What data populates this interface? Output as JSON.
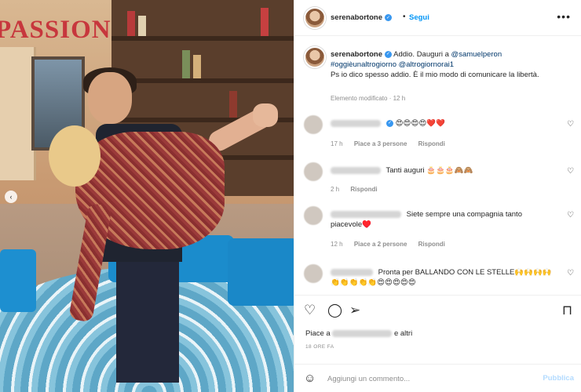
{
  "media": {
    "sign_text": "PASSIONI",
    "prev_glyph": "‹"
  },
  "header": {
    "username": "serenabortone",
    "verified_glyph": "✓",
    "separator": "•",
    "follow_label": "Segui",
    "more_glyph": "•••"
  },
  "caption": {
    "username": "serenabortone",
    "text_1": "Addio. Dauguri a ",
    "mention_1": "@samuelperon",
    "hashtag": "#oggièunaltrogiorno",
    "mention_2": "@altrogiornorai1",
    "text_2": "Ps io dico spesso addio. È il mio modo di comunicare la libertà.",
    "edited": "Elemento modificato · 12 h"
  },
  "comments": [
    {
      "text": "😍😍😍😍❤️❤️",
      "time": "17 h",
      "likes": "Piace a 3 persone",
      "reply": "Rispondi"
    },
    {
      "text": "Tanti auguri 🎂🎂🎂🙈🙈",
      "time": "2 h",
      "likes": "",
      "reply": "Rispondi"
    },
    {
      "text": "Siete sempre una compagnia tanto piacevole♥️",
      "time": "12 h",
      "likes": "Piace a 2 persone",
      "reply": "Rispondi"
    },
    {
      "text": "Pronta per BALLANDO CON LE STELLE🙌🙌🙌🙌👏👏👏👏👏😍😍😍😍😍",
      "time": "",
      "likes": "",
      "reply": ""
    }
  ],
  "icons": {
    "heart": "♡",
    "comment": "◯",
    "share": "➢",
    "save": "⊓",
    "emoji": "☺"
  },
  "likes": {
    "prefix": "Piace a",
    "suffix": "e altri"
  },
  "time_ago": "18 ORE FA",
  "add_comment": {
    "placeholder": "Aggiungi un commento...",
    "publish_label": "Pubblica"
  }
}
